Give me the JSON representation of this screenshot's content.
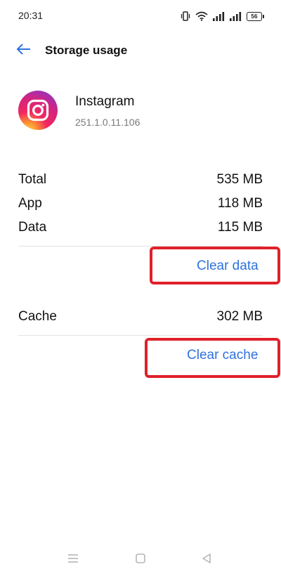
{
  "status_bar": {
    "time": "20:31",
    "battery_level": "56",
    "icons": [
      "vibrate-icon",
      "wifi-icon",
      "signal-icon",
      "signal-icon",
      "battery-icon"
    ]
  },
  "header": {
    "title": "Storage usage",
    "back_icon": "arrow-left-icon"
  },
  "app": {
    "name": "Instagram",
    "version": "251.1.0.11.106",
    "icon": "instagram-icon"
  },
  "storage": {
    "total": {
      "label": "Total",
      "value": "535 MB"
    },
    "app": {
      "label": "App",
      "value": "118 MB"
    },
    "data": {
      "label": "Data",
      "value": "115 MB"
    },
    "cache": {
      "label": "Cache",
      "value": "302 MB"
    }
  },
  "actions": {
    "clear_data": "Clear data",
    "clear_cache": "Clear cache"
  },
  "colors": {
    "accent": "#2f72de",
    "highlight": "#e0202a"
  },
  "nav": {
    "icons": [
      "menu-icon",
      "home-icon",
      "back-triangle-icon"
    ]
  }
}
